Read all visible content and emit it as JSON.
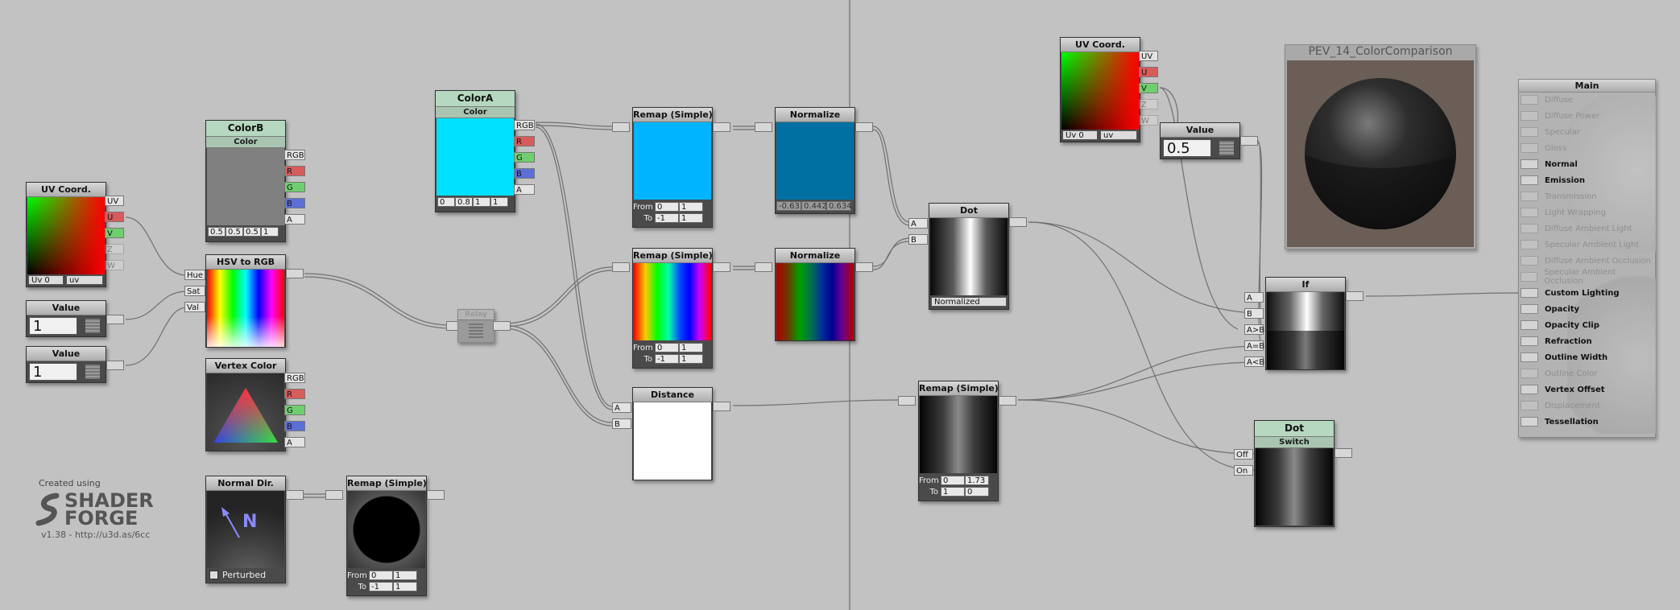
{
  "nodes": {
    "uv_left": {
      "title": "UV Coord.",
      "outputs": [
        "UV",
        "U",
        "V",
        "Z",
        "W"
      ],
      "channel": "Uv 0",
      "mode": "uv"
    },
    "value_1a": {
      "title": "Value",
      "value": "1"
    },
    "value_1b": {
      "title": "Value",
      "value": "1"
    },
    "color_b": {
      "title": "ColorB",
      "subtitle": "Color",
      "outputs": [
        "RGB",
        "R",
        "G",
        "B",
        "A"
      ],
      "values": [
        "0.5",
        "0.5",
        "0.5",
        "1"
      ],
      "swatch": "#808080"
    },
    "hsv_to_rgb": {
      "title": "HSV to RGB",
      "inputs": [
        "Hue",
        "Sat",
        "Val"
      ]
    },
    "vertex_color": {
      "title": "Vertex Color",
      "outputs": [
        "RGB",
        "R",
        "G",
        "B",
        "A"
      ]
    },
    "normal_dir": {
      "title": "Normal Dir.",
      "glyph": "N",
      "checkbox_label": "Perturbed"
    },
    "remap_normal": {
      "title": "Remap (Simple)",
      "from_label": "From",
      "to_label": "To",
      "from": [
        "0",
        "1"
      ],
      "to": [
        "-1",
        "1"
      ]
    },
    "relay": {
      "title": "Relay"
    },
    "color_a": {
      "title": "ColorA",
      "subtitle": "Color",
      "outputs": [
        "RGB",
        "R",
        "G",
        "B",
        "A"
      ],
      "values": [
        "0",
        "0.8",
        "1",
        "1"
      ],
      "swatch": "#00e0ff"
    },
    "remap_top": {
      "title": "Remap (Simple)",
      "from_label": "From",
      "to_label": "To",
      "from": [
        "0",
        "1"
      ],
      "to": [
        "-1",
        "1"
      ]
    },
    "remap_mid": {
      "title": "Remap (Simple)",
      "from_label": "From",
      "to_label": "To",
      "from": [
        "0",
        "1"
      ],
      "to": [
        "-1",
        "1"
      ]
    },
    "normalize_top": {
      "title": "Normalize",
      "values": [
        "-0.63",
        "0.442",
        "0.634"
      ]
    },
    "normalize_mid": {
      "title": "Normalize"
    },
    "distance": {
      "title": "Distance",
      "inputs": [
        "A",
        "B"
      ]
    },
    "dot_main": {
      "title": "Dot",
      "inputs": [
        "A",
        "B"
      ],
      "mode": "Normalized"
    },
    "remap_right": {
      "title": "Remap (Simple)",
      "from_label": "From",
      "to_label": "To",
      "from": [
        "0",
        "1.73"
      ],
      "to": [
        "1",
        "0"
      ]
    },
    "uv_right": {
      "title": "UV Coord.",
      "outputs": [
        "UV",
        "U",
        "V",
        "Z",
        "W"
      ],
      "channel": "Uv 0",
      "mode": "uv"
    },
    "value_half": {
      "title": "Value",
      "value": "0.5"
    },
    "if_node": {
      "title": "If",
      "inputs": [
        "A",
        "B",
        "A>B",
        "A=B",
        "A<B"
      ]
    },
    "dot_switch": {
      "title": "Dot",
      "subtitle": "Switch",
      "inputs": [
        "Off",
        "On"
      ]
    }
  },
  "preview": {
    "title": "PEV_14_ColorComparison"
  },
  "main_panel": {
    "title": "Main",
    "inputs": [
      {
        "label": "Diffuse",
        "active": false
      },
      {
        "label": "Diffuse Power",
        "active": false
      },
      {
        "label": "Specular",
        "active": false
      },
      {
        "label": "Gloss",
        "active": false
      },
      {
        "label": "Normal",
        "active": true
      },
      {
        "label": "Emission",
        "active": true
      },
      {
        "label": "Transmission",
        "active": false
      },
      {
        "label": "Light Wrapping",
        "active": false
      },
      {
        "label": "Diffuse Ambient Light",
        "active": false
      },
      {
        "label": "Specular Ambient Light",
        "active": false
      },
      {
        "label": "Diffuse Ambient Occlusion",
        "active": false
      },
      {
        "label": "Specular Ambient Occlusion",
        "active": false
      },
      {
        "label": "Custom Lighting",
        "active": true
      },
      {
        "label": "Opacity",
        "active": true
      },
      {
        "label": "Opacity Clip",
        "active": true
      },
      {
        "label": "Refraction",
        "active": true
      },
      {
        "label": "Outline Width",
        "active": true
      },
      {
        "label": "Outline Color",
        "active": false
      },
      {
        "label": "Vertex Offset",
        "active": true
      },
      {
        "label": "Displacement",
        "active": false
      },
      {
        "label": "Tessellation",
        "active": true
      }
    ]
  },
  "branding": {
    "created_using": "Created using",
    "brand_top": "SHADER",
    "brand_bottom": "FORGE",
    "version": "v1.38 - http://u3d.as/6cc"
  }
}
